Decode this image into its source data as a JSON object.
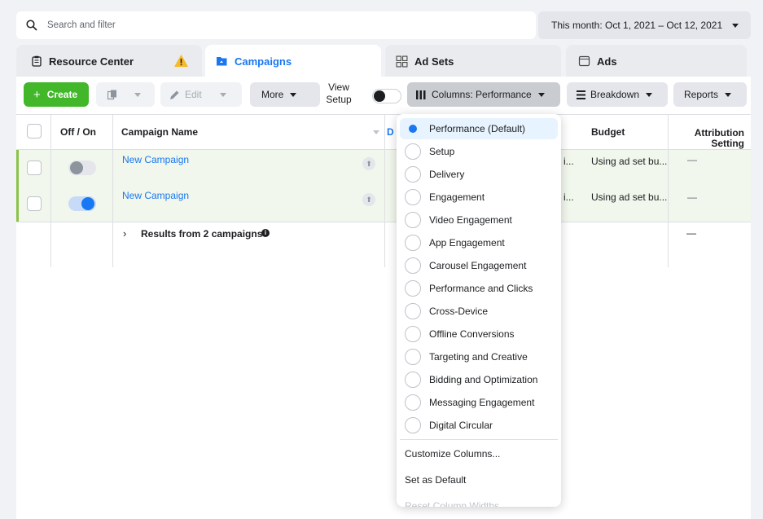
{
  "search": {
    "placeholder": "Search and filter"
  },
  "date_range": {
    "label": "This month: Oct 1, 2021 – Oct 12, 2021"
  },
  "tabs": [
    {
      "label": "Resource Center",
      "warning_icon": "warning-icon"
    },
    {
      "label": "Campaigns"
    },
    {
      "label": "Ad Sets"
    },
    {
      "label": "Ads"
    }
  ],
  "toolbar": {
    "create": "Create",
    "edit": "Edit",
    "more": "More",
    "view_setup_line1": "View",
    "view_setup_line2": "Setup",
    "columns": "Columns: Performance",
    "breakdown": "Breakdown",
    "reports": "Reports"
  },
  "table": {
    "headers": {
      "off_on": "Off / On",
      "campaign_name": "Campaign Name",
      "delivery_partial": "D",
      "budget": "Budget",
      "attribution_line1": "Attribution",
      "attribution_line2": "Setting"
    },
    "rows": [
      {
        "name": "New Campaign",
        "toggle_on": false,
        "partial": "i...",
        "budget": "Using ad set bu...",
        "attribution": "—"
      },
      {
        "name": "New Campaign",
        "toggle_on": true,
        "partial": "i...",
        "budget": "Using ad set bu...",
        "attribution": "—"
      }
    ],
    "results": {
      "label": "Results from 2 campaigns",
      "attribution": "—"
    }
  },
  "columns_menu": {
    "options": [
      "Performance (Default)",
      "Setup",
      "Delivery",
      "Engagement",
      "Video Engagement",
      "App Engagement",
      "Carousel Engagement",
      "Performance and Clicks",
      "Cross-Device",
      "Offline Conversions",
      "Targeting and Creative",
      "Bidding and Optimization",
      "Messaging Engagement",
      "Digital Circular"
    ],
    "selected_index": 0,
    "actions": [
      "Customize Columns...",
      "Set as Default",
      "Reset Column Widths"
    ]
  },
  "colors": {
    "accent": "#1877f2",
    "create_green": "#42b72a",
    "row_highlight": "#f1f7ec"
  }
}
